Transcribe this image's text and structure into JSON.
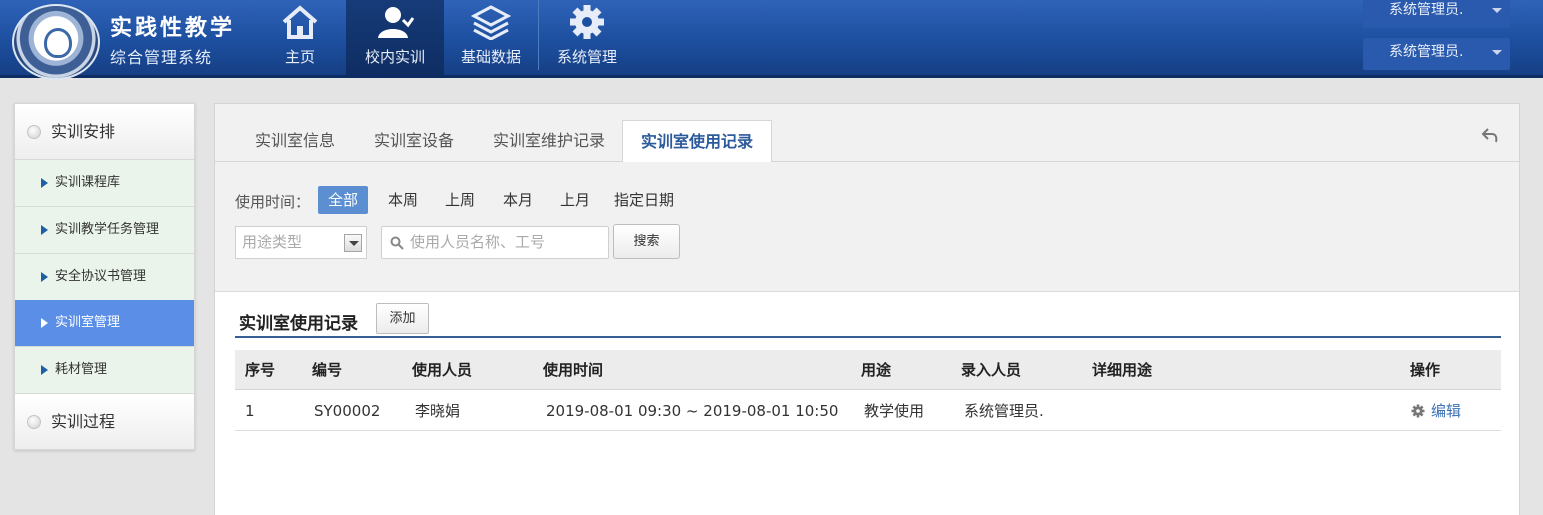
{
  "header": {
    "title": "实践性教学",
    "subtitle": "综合管理系统",
    "nav": [
      {
        "label": "主页",
        "icon": "home-icon"
      },
      {
        "label": "校内实训",
        "icon": "user-icon",
        "active": true
      },
      {
        "label": "基础数据",
        "icon": "layers-icon"
      },
      {
        "label": "系统管理",
        "icon": "gear-icon"
      }
    ],
    "user_dropdowns": [
      "系统管理员.",
      "系统管理员."
    ]
  },
  "sidebar": {
    "groups": [
      {
        "label": "实训安排"
      },
      {
        "label": "实训过程"
      }
    ],
    "items": [
      {
        "label": "实训课程库"
      },
      {
        "label": "实训教学任务管理"
      },
      {
        "label": "安全协议书管理"
      },
      {
        "label": "实训室管理",
        "active": true
      },
      {
        "label": "耗材管理"
      }
    ]
  },
  "tabs": [
    {
      "label": "实训室信息"
    },
    {
      "label": "实训室设备"
    },
    {
      "label": "实训室维护记录"
    },
    {
      "label": "实训室使用记录",
      "active": true
    }
  ],
  "filter": {
    "time_label": "使用时间：",
    "time_options": [
      "全部",
      "本周",
      "上周",
      "本月",
      "上月",
      "指定日期"
    ],
    "selected_time": "全部",
    "type_select_placeholder": "用途类型",
    "search_placeholder": "使用人员名称、工号",
    "search_button": "搜索"
  },
  "section": {
    "title": "实训室使用记录",
    "add_button": "添加"
  },
  "table": {
    "columns": [
      "序号",
      "编号",
      "使用人员",
      "使用时间",
      "用途",
      "录入人员",
      "详细用途",
      "操作"
    ],
    "rows": [
      {
        "index": "1",
        "code": "SY00002",
        "user": "李晓娟",
        "time": "2019-08-01 09:30 ~ 2019-08-01 10:50",
        "purpose": "教学使用",
        "recorder": "系统管理员.",
        "detail": "",
        "action": "编辑"
      }
    ]
  },
  "colors": {
    "header_blue": "#1d4f9f",
    "active_blue": "#5b8ee6",
    "link_blue": "#3c71b6"
  }
}
